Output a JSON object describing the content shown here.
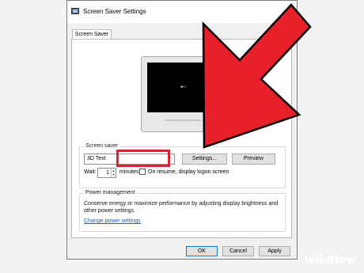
{
  "window": {
    "title": "Screen Saver Settings",
    "tab_label": "Screen Saver"
  },
  "screen_saver": {
    "group_label": "Screen saver",
    "selected_value": "3D Text",
    "settings_button": "Settings...",
    "preview_button": "Preview",
    "wait_label": "Wait:",
    "wait_value": "1",
    "minutes_label": "minutes",
    "logon_checkbox_label": "On resume, display logon screen",
    "logon_checked": false
  },
  "power_management": {
    "group_label": "Power management",
    "description": "Conserve energy or maximize performance by adjusting display brightness and other power settings.",
    "link_label": "Change power settings"
  },
  "footer": {
    "ok_button": "OK",
    "cancel_button": "Cancel",
    "apply_button": "Apply"
  },
  "watermark": {
    "text": "wikiHow"
  },
  "colors": {
    "highlight": "#e0202e",
    "arrow": "#e8202a",
    "link": "#0066cc"
  }
}
